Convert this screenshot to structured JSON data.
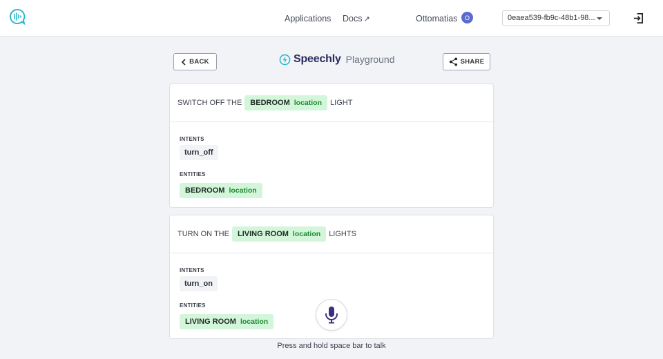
{
  "nav": {
    "applications": "Applications",
    "docs": "Docs",
    "docs_external_glyph": "↗",
    "user_name": "Ottomatias",
    "user_initial": "O",
    "app_id": "0eaea539-fb9c-48b1-98..."
  },
  "header": {
    "back_label": "BACK",
    "brand": "Speechly",
    "brand_sub": "Playground",
    "share_label": "SHARE"
  },
  "transcripts": [
    {
      "before": "SWITCH OFF THE",
      "entity_value": "BEDROOM",
      "entity_type": "location",
      "after": "LIGHT",
      "intents_label": "INTENTS",
      "intent": "turn_off",
      "entities_label": "ENTITIES"
    },
    {
      "before": "TURN ON THE",
      "entity_value": "LIVING ROOM",
      "entity_type": "location",
      "after": "LIGHTS",
      "intents_label": "INTENTS",
      "intent": "turn_on",
      "entities_label": "ENTITIES"
    }
  ],
  "hint": "Press and hold space bar to talk",
  "colors": {
    "accent_teal": "#2bb6c9",
    "brand_navy": "#2a2b5e",
    "entity_bg": "#d3f5da",
    "entity_text": "#1a8c2e",
    "mic_purple": "#3d2f7a",
    "badge": "#5b6ad0"
  },
  "icons": {
    "logo": "speechly-logo-icon",
    "back": "chevron-left-icon",
    "share": "share-icon",
    "logout": "logout-icon",
    "mic": "microphone-icon",
    "select": "caret-down-icon"
  }
}
